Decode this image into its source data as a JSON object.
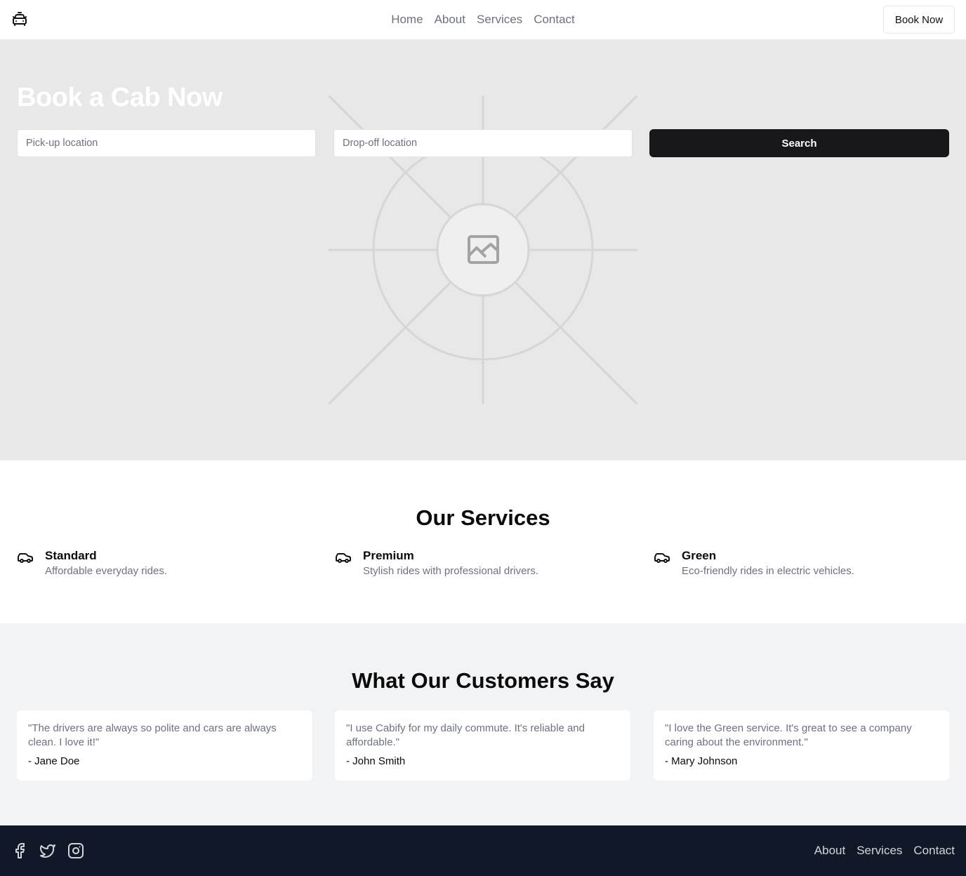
{
  "header": {
    "logo_icon": "taxi-icon",
    "nav": [
      "Home",
      "About",
      "Services",
      "Contact"
    ],
    "cta_label": "Book Now"
  },
  "hero": {
    "title": "Book a Cab Now",
    "pickup_placeholder": "Pick-up location",
    "dropoff_placeholder": "Drop-off location",
    "search_label": "Search",
    "background_icon": "image-placeholder-icon"
  },
  "services": {
    "title": "Our Services",
    "items": [
      {
        "name": "Standard",
        "description": "Affordable everyday rides.",
        "icon": "car-icon"
      },
      {
        "name": "Premium",
        "description": "Stylish rides with professional drivers.",
        "icon": "car-icon"
      },
      {
        "name": "Green",
        "description": "Eco-friendly rides in electric vehicles.",
        "icon": "car-icon"
      }
    ]
  },
  "testimonials": {
    "title": "What Our Customers Say",
    "items": [
      {
        "quote": "\"The drivers are always so polite and cars are always clean. I love it!\"",
        "author": "- Jane Doe"
      },
      {
        "quote": "\"I use Cabify for my daily commute. It's reliable and affordable.\"",
        "author": "- John Smith"
      },
      {
        "quote": "\"I love the Green service. It's great to see a company caring about the environment.\"",
        "author": "- Mary Johnson"
      }
    ]
  },
  "footer": {
    "social_icons": [
      "facebook-icon",
      "twitter-icon",
      "instagram-icon"
    ],
    "nav": [
      "About",
      "Services",
      "Contact"
    ]
  },
  "colors": {
    "hero_bg": "#e8e8e8",
    "primary_button": "#18181b",
    "muted_text": "#6b7280",
    "testimonials_bg": "#f2f3f5",
    "footer_bg": "#111827"
  }
}
